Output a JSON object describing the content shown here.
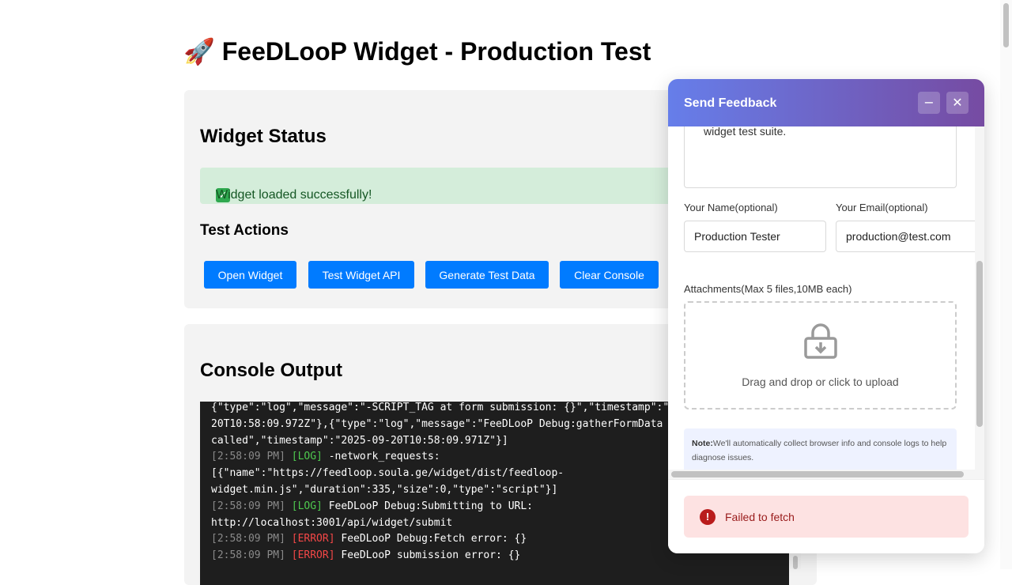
{
  "page": {
    "title": "🚀 FeeDLooP Widget - Production Test"
  },
  "status": {
    "heading": "Widget Status",
    "success_message": "Widget loaded successfully!",
    "actions_heading": "Test Actions",
    "buttons": [
      {
        "label": "Open Widget"
      },
      {
        "label": "Test Widget API"
      },
      {
        "label": "Generate Test Data"
      },
      {
        "label": "Clear Console"
      }
    ]
  },
  "console": {
    "heading": "Console Output",
    "lines": [
      {
        "text": "{\"type\":\"log\",\"message\":\"-SCRIPT_TAG at form submission: {}\",\"timestamp\":\""
      },
      {
        "text": "20T10:58:09.972Z\"},{\"type\":\"log\",\"message\":\"FeeDLooP Debug:gatherFormData"
      },
      {
        "text": "called\",\"timestamp\":\"2025-09-20T10:58:09.971Z\"}]"
      },
      {
        "time": "[2:58:09 PM]",
        "level": "[LOG]",
        "text": " -network_requests:"
      },
      {
        "text": "[{\"name\":\"https://feedloop.soula.ge/widget/dist/feedloop-"
      },
      {
        "text": "widget.min.js\",\"duration\":335,\"size\":0,\"type\":\"script\"}]"
      },
      {
        "time": "[2:58:09 PM]",
        "level": "[LOG]",
        "text": " FeeDLooP Debug:Submitting to URL:"
      },
      {
        "text": "http://localhost:3001/api/widget/submit"
      },
      {
        "time": "[2:58:09 PM]",
        "level": "[ERROR]",
        "text": " FeeDLooP Debug:Fetch error: {}"
      },
      {
        "time": "[2:58:09 PM]",
        "level": "[ERROR]",
        "text": " FeeDLooP submission error: {}"
      }
    ]
  },
  "widget": {
    "title": "Send Feedback",
    "minimize_label": "−",
    "close_label": "✕",
    "description_value": "widget test suite.",
    "name_label": "Your Name(optional)",
    "name_value": "Production Tester",
    "email_label": "Your Email(optional)",
    "email_value": "production@test.com",
    "attachments_label": "Attachments(Max 5 files,10MB each)",
    "upload_text": "Drag and drop or click to upload",
    "note_bold": "Note:",
    "note_text": "We'll automatically collect browser info and console logs to help diagnose issues.",
    "error_message": "Failed to fetch",
    "error_icon": "!"
  },
  "colors": {
    "primary_button": "#007bff",
    "success_bg": "#d4edda",
    "header_gradient_start": "#667eea",
    "header_gradient_end": "#764ba2",
    "error_bg": "#fde2e2"
  },
  "icons": {
    "rocket": "rocket-icon",
    "check": "check-icon",
    "upload": "upload-icon",
    "error": "error-icon"
  }
}
